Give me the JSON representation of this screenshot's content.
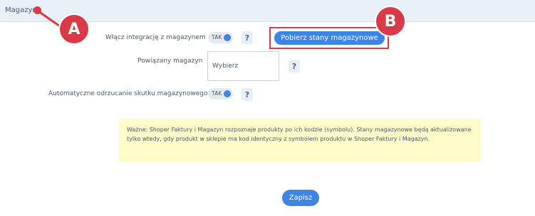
{
  "header": {
    "title": "Magazyn"
  },
  "callouts": {
    "a": "A",
    "b": "B"
  },
  "form": {
    "integration_label": "Włącz integrację z magazynem",
    "integration_toggle": "TAK",
    "fetch_button": "Pobierz stany magazynowe",
    "linked_label": "Powiązany magazyn",
    "linked_select_value": "Wybierz",
    "auto_label": "Automatyczne odrzucanie skutku magazynowego",
    "auto_toggle": "TAK",
    "help": "?"
  },
  "notice": "Ważne: Shoper Faktury i Magazyn rozpoznaje produkty po ich kodzie (symbolu). Stany magazynowe będą aktualizowane tylko wtedy, gdy produkt w sklepie ma kod identyczny z symbolem produktu w Shoper Faktury i Magazyn.",
  "save_button": "Zapisz",
  "colors": {
    "accent": "#3d84e6",
    "callout": "#d83a47",
    "notice_bg": "#fdfbc8"
  }
}
